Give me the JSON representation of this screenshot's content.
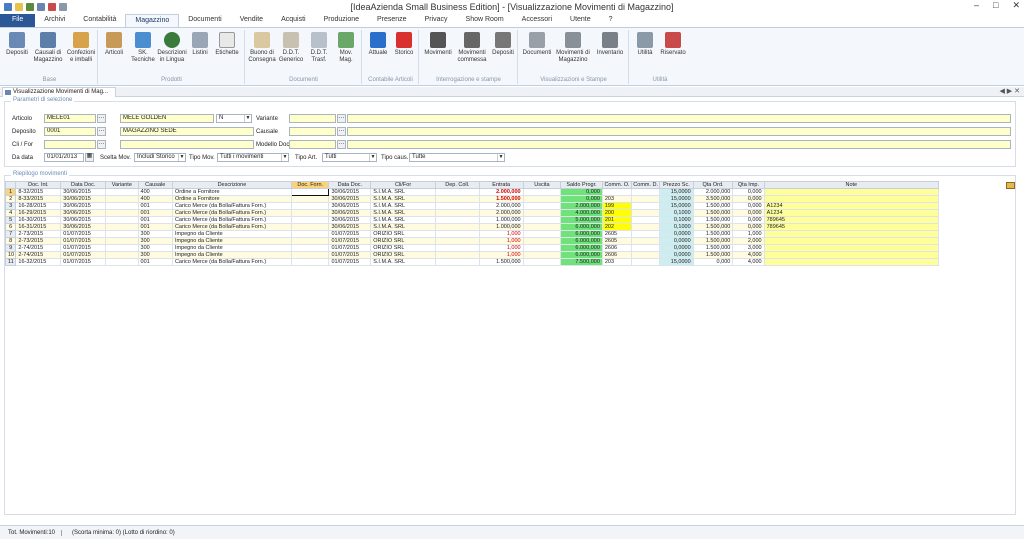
{
  "window": {
    "title": "[IdeaAzienda Small Business Edition] - [Visualizzazione Movimenti di Magazzino]",
    "controls": [
      "–",
      "□",
      "✕"
    ]
  },
  "ribbon_tabs": [
    "File",
    "Archivi",
    "Contabilità",
    "Magazzino",
    "Documenti",
    "Vendite",
    "Acquisti",
    "Produzione",
    "Presenze",
    "Privacy",
    "Show Room",
    "Accessori",
    "Utente",
    "?"
  ],
  "ribbon": {
    "groups": [
      {
        "label": "Base",
        "buttons": [
          "Depositi",
          "Causali di Magazzino",
          "Confezioni e imballi"
        ]
      },
      {
        "label": "Prodotti",
        "buttons": [
          "Articoli",
          "SK. Tecniche",
          "Descrizioni in Lingua",
          "Listini",
          "Etichette"
        ]
      },
      {
        "label": "Documenti",
        "buttons": [
          "Buono di Consegna",
          "D.D.T. Generico",
          "D.D.T. Trasf.",
          "Mov. Mag."
        ]
      },
      {
        "label": "Contabile Articoli",
        "buttons": [
          "Attuale",
          "Storico"
        ]
      },
      {
        "label": "Interrogazione e stampe",
        "buttons": [
          "Movimenti",
          "Movimenti commessa",
          "Depositi"
        ]
      },
      {
        "label": "Visualizzazioni e Stampe",
        "buttons": [
          "Documenti",
          "Movimenti di Magazzino",
          "Inventario"
        ]
      },
      {
        "label": "Utilità",
        "buttons": [
          "Utilità",
          "Riservato"
        ]
      }
    ]
  },
  "doc_tab": {
    "label": "Visualizzazione Movimenti di Mag...",
    "nav": "◀ ▶ ✕"
  },
  "filters": {
    "legend": "Parametri di selezione",
    "articolo_label": "Articolo",
    "articolo_code": "MELE01",
    "articolo_desc": "MELE GOLDEN",
    "articolo_flag": "N",
    "variante_label": "Variante",
    "deposito_label": "Deposito",
    "deposito_code": "0001",
    "deposito_desc": "MAGAZZINO SEDE",
    "causale_label": "Causale",
    "clifor_label": "Cli / For",
    "modello_label": "Modello Doc",
    "dadata_label": "Da data",
    "dadata_value": "01/01/2013",
    "scelta_label": "Scelta Mov.",
    "scelta_value": "Includi Storico",
    "tipomov_label": "Tipo Mov.",
    "tipomov_value": "Tutti i movimenti",
    "tipoart_label": "Tipo Art.",
    "tipoart_value": "Tutti",
    "tipocaus_label": "Tipo caus.",
    "tipocaus_value": "Tutte"
  },
  "movements": {
    "legend": "Riepilogo movimenti",
    "columns": [
      "",
      "Doc. Int.",
      "Data Doc.",
      "Variante",
      "Causale",
      "Descrizione",
      "Doc. Forn.",
      "Data Doc.",
      "Cli/For",
      "Dep. Coll.",
      "Entrata",
      "Uscita",
      "Saldo Progr.",
      "Comm. O.",
      "Comm. D.",
      "Prezzo Sc.",
      "Qta Ord.",
      "Qta Imp.",
      "Note"
    ],
    "rows": [
      [
        "1",
        "8-32/2015",
        "30/06/2015",
        "",
        "400",
        "Ordine a Fornitore",
        "",
        "30/06/2015",
        "S.I.M.A. SRL",
        "",
        "2.000,000",
        "",
        "0,000",
        "",
        "",
        "15,0000",
        "2.000,000",
        "0,000",
        ""
      ],
      [
        "2",
        "8-33/2015",
        "30/06/2015",
        "",
        "400",
        "Ordine a Fornitore",
        "",
        "30/06/2015",
        "S.I.M.A. SRL",
        "",
        "1.500,000",
        "",
        "0,000",
        "203",
        "",
        "15,0000",
        "3.500,000",
        "0,000",
        ""
      ],
      [
        "3",
        "16-28/2015",
        "30/06/2015",
        "",
        "001",
        "Carico Merce (da Bolla/Fattura Forn.)",
        "",
        "30/06/2015",
        "S.I.M.A. SRL",
        "",
        "2.000,000",
        "",
        "2.000,000",
        "199",
        "",
        "15,0000",
        "1.500,000",
        "0,000",
        "A1234"
      ],
      [
        "4",
        "16-29/2015",
        "30/06/2015",
        "",
        "001",
        "Carico Merce (da Bolla/Fattura Forn.)",
        "",
        "30/06/2015",
        "S.I.M.A. SRL",
        "",
        "2.000,000",
        "",
        "4.000,000",
        "200",
        "",
        "0,1000",
        "1.500,000",
        "0,000",
        "A1234"
      ],
      [
        "5",
        "16-30/2015",
        "30/06/2015",
        "",
        "001",
        "Carico Merce (da Bolla/Fattura Forn.)",
        "",
        "30/06/2015",
        "S.I.M.A. SRL",
        "",
        "1.000,000",
        "",
        "5.000,000",
        "201",
        "",
        "0,1000",
        "1.500,000",
        "0,000",
        "789645"
      ],
      [
        "6",
        "16-31/2015",
        "30/06/2015",
        "",
        "001",
        "Carico Merce (da Bolla/Fattura Forn.)",
        "",
        "30/06/2015",
        "S.I.M.A. SRL",
        "",
        "1.000,000",
        "",
        "6.000,000",
        "202",
        "",
        "0,1000",
        "1.500,000",
        "0,000",
        "789645"
      ],
      [
        "7",
        "2-73/2015",
        "01/07/2015",
        "",
        "300",
        "Impegno da Cliente",
        "",
        "01/07/2015",
        "ORIZIO SRL",
        "",
        "1,000",
        "",
        "6.000,000",
        "2605",
        "",
        "0,0000",
        "1.500,000",
        "1,000",
        ""
      ],
      [
        "8",
        "2-73/2015",
        "01/07/2015",
        "",
        "300",
        "Impegno da Cliente",
        "",
        "01/07/2015",
        "ORIZIO SRL",
        "",
        "1,000",
        "",
        "6.000,000",
        "2605",
        "",
        "0,0000",
        "1.500,000",
        "2,000",
        ""
      ],
      [
        "9",
        "2-74/2015",
        "01/07/2015",
        "",
        "300",
        "Impegno da Cliente",
        "",
        "01/07/2015",
        "ORIZIO SRL",
        "",
        "1,000",
        "",
        "6.000,000",
        "2606",
        "",
        "0,0000",
        "1.500,000",
        "3,000",
        ""
      ],
      [
        "10",
        "2-74/2015",
        "01/07/2015",
        "",
        "300",
        "Impegno da Cliente",
        "",
        "01/07/2015",
        "ORIZIO SRL",
        "",
        "1,000",
        "",
        "6.000,000",
        "2606",
        "",
        "0,0000",
        "1.500,000",
        "4,000",
        ""
      ],
      [
        "11",
        "16-32/2015",
        "01/07/2015",
        "",
        "001",
        "Carico Merce (da Bolla/Fattura Forn.)",
        "",
        "01/07/2015",
        "S.I.M.A. SRL",
        "",
        "1.500,000",
        "",
        "7.500,000",
        "203",
        "",
        "15,0000",
        "0,000",
        "4,000",
        ""
      ]
    ]
  },
  "status": {
    "tot": "Tot. Movimenti:10",
    "info": "(Scorta minima: 0) (Lotto di riordino: 0)"
  },
  "colors": {
    "file_tab": "#2b5797",
    "field_yellow": "#ffffcc",
    "balance_green": "#6fe27a",
    "commission_yellow": "#ffff00",
    "price_cyan": "#cdeef0",
    "notes_yellow": "#ffff99",
    "entry_red": "#d00000"
  }
}
